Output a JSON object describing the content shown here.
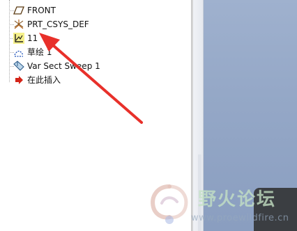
{
  "model_tree": {
    "items": [
      {
        "label": "FRONT",
        "icon": "datum-plane-icon"
      },
      {
        "label": "PRT_CSYS_DEF",
        "icon": "coordinate-system-icon"
      },
      {
        "label": "11",
        "icon": "sketch-feature-icon"
      },
      {
        "label": "草绘 1",
        "icon": "sketch-icon"
      },
      {
        "label": "Var Sect Sweep 1",
        "icon": "sweep-feature-icon"
      },
      {
        "label": "在此插入",
        "icon": "insert-here-arrow-icon"
      }
    ]
  },
  "annotation": {
    "arrow_color": "#e8302a"
  },
  "watermark": {
    "text": "野火论坛",
    "url": "www.proewildfire.cn"
  }
}
